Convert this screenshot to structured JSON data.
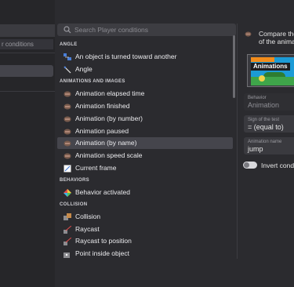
{
  "left_panel": {
    "conditions_label": "r conditions"
  },
  "search": {
    "placeholder": "Search Player conditions"
  },
  "sections": [
    {
      "header": "ANGLE",
      "items": [
        {
          "label": "An object is turned toward another",
          "icon": "turn-toward-icon"
        },
        {
          "label": "Angle",
          "icon": "angle-icon"
        }
      ]
    },
    {
      "header": "ANIMATIONS AND IMAGES",
      "items": [
        {
          "label": "Animation elapsed time",
          "icon": "film-icon"
        },
        {
          "label": "Animation finished",
          "icon": "film-icon"
        },
        {
          "label": "Animation (by number)",
          "icon": "film-icon"
        },
        {
          "label": "Animation paused",
          "icon": "film-icon"
        },
        {
          "label": "Animation (by name)",
          "icon": "film-icon",
          "selected": true
        },
        {
          "label": "Animation speed scale",
          "icon": "film-icon"
        },
        {
          "label": "Current frame",
          "icon": "current-frame-icon"
        }
      ]
    },
    {
      "header": "BEHAVIORS",
      "items": [
        {
          "label": "Behavior activated",
          "icon": "behavior-icon"
        }
      ]
    },
    {
      "header": "COLLISION",
      "items": [
        {
          "label": "Collision",
          "icon": "collision-icon"
        },
        {
          "label": "Raycast",
          "icon": "raycast-icon"
        },
        {
          "label": "Raycast to position",
          "icon": "raycast-icon"
        },
        {
          "label": "Point inside object",
          "icon": "point-inside-icon"
        }
      ]
    }
  ],
  "details": {
    "description_line1": "Compare the a",
    "description_line2": "of the animati",
    "thumbnail_badge": "Animations",
    "fields": [
      {
        "label": "Behavior",
        "value": "Animation",
        "disabled": true
      },
      {
        "label": "Sign of the test",
        "value": "= (equal to)"
      },
      {
        "label": "Animation name",
        "value": "jump"
      }
    ],
    "invert_label": "Invert conditi"
  },
  "colors": {
    "background": "#2b2b2f",
    "selected_row": "#45454c",
    "field_bg": "#3a3a3f",
    "film_icon": "#8a6a5a"
  }
}
